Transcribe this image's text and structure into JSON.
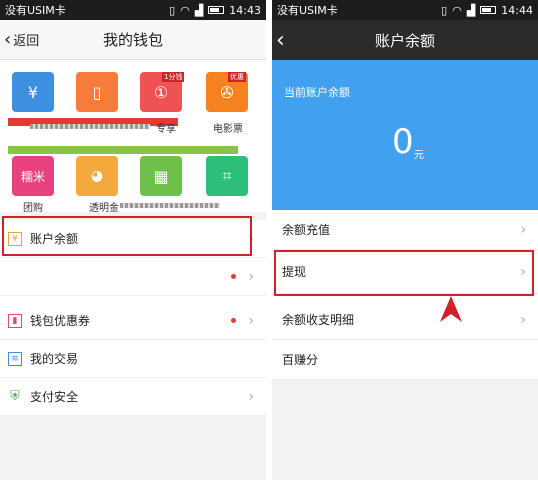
{
  "left": {
    "status": {
      "carrier": "没有USIM卡",
      "time": "14:43"
    },
    "title": "我的钱包",
    "back_label": "返回",
    "tiles": [
      {
        "icon": "yen-cycle-icon",
        "glyph": "¥",
        "label": "",
        "color": "#3d8fe0"
      },
      {
        "icon": "phone-icon",
        "glyph": "▯",
        "label": "",
        "color": "#f57c3a"
      },
      {
        "icon": "one-yuan-icon",
        "glyph": "①",
        "label": "",
        "color": "#ef5252"
      },
      {
        "icon": "film-reel-icon",
        "glyph": "✇",
        "label": "电影票",
        "color": "#f5821f"
      },
      {
        "icon": "nuomi-icon",
        "glyph": "糯米",
        "label": "团购",
        "color": "#e8417f"
      },
      {
        "icon": "piggy-bank-icon",
        "glyph": "🐖",
        "label": "透明金",
        "color": "#f3a93b"
      },
      {
        "icon": "qr-code-icon",
        "glyph": "▦",
        "label": "",
        "color": "#6fc04a"
      },
      {
        "icon": "scan-icon",
        "glyph": "⌗",
        "label": "",
        "color": "#2bbf7a"
      }
    ],
    "tile_badge_1": "1分钱",
    "tile_badge_2": "优惠",
    "row2_label": "专享",
    "list": [
      {
        "label": "账户余额",
        "icon": "wallet-icon"
      },
      {
        "label": "",
        "icon": ""
      },
      {
        "label": "钱包优惠券",
        "icon": "coupon-icon"
      },
      {
        "label": "我的交易",
        "icon": "list-icon"
      },
      {
        "label": "支付安全",
        "icon": "shield-icon"
      }
    ]
  },
  "right": {
    "status": {
      "carrier": "没有USIM卡",
      "time": "14:44"
    },
    "title": "账户余额",
    "balance_label": "当前账户余额",
    "balance_amount": "0",
    "balance_unit": "元",
    "list": [
      {
        "label": "余额充值"
      },
      {
        "label": "提现"
      },
      {
        "label": "余额收支明细"
      },
      {
        "label": "百赚分"
      }
    ]
  },
  "colors": {
    "highlight": "#d0202a",
    "balance_bg": "#42a0f0"
  }
}
